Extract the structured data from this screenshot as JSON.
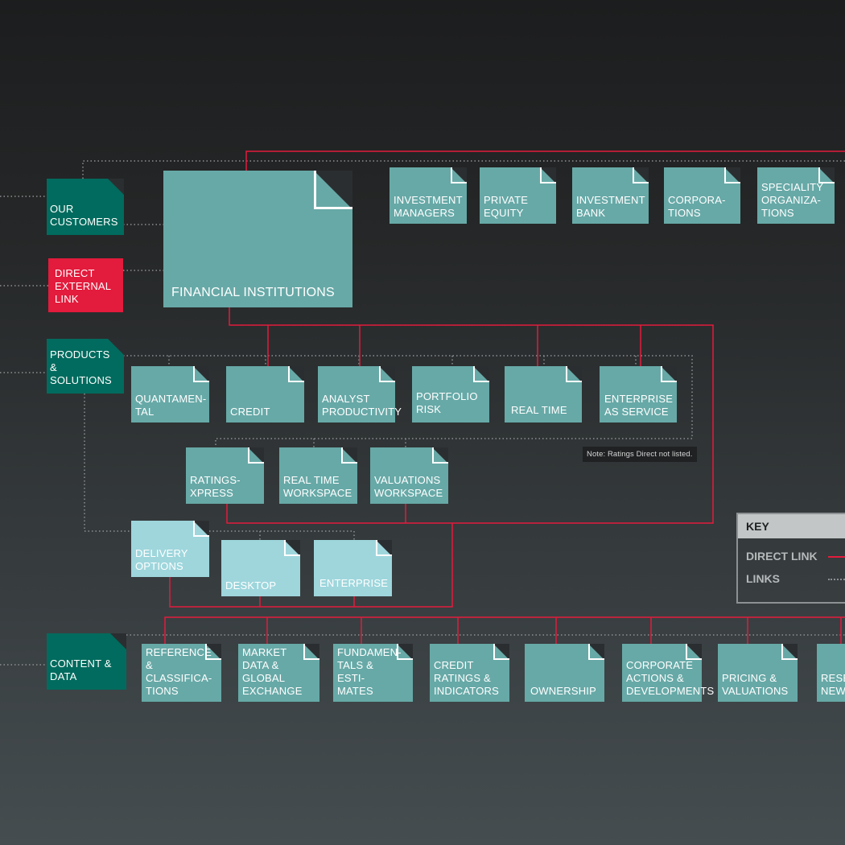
{
  "colors": {
    "teal": "#67a9a7",
    "dark_teal": "#006b5e",
    "red": "#e31b3c",
    "light_teal": "#9ed6dc",
    "direct_link": "#e31b3c",
    "link": "#8c9092"
  },
  "sidebar": {
    "our_customers": "OUR CUSTOMERS",
    "direct_external_link": "DIRECT EXTERNAL LINK",
    "products_solutions": "PRODUCTS & SOLUTIONS",
    "content_data": "CONTENT & DATA"
  },
  "financial_institutions": "FINANCIAL INSTITUTIONS",
  "customers": [
    "INVESTMENT MANAGERS",
    "PRIVATE EQUITY",
    "INVESTMENT BANK",
    "CORPORA- TIONS",
    "SPECIALITY ORGANIZA- TIONS"
  ],
  "products": [
    "QUANTAMEN- TAL",
    "CREDIT",
    "ANALYST PRODUCTIVITY",
    "PORTFOLIO RISK",
    "REAL TIME",
    "ENTERPRISE AS SERVICE"
  ],
  "sub_products": [
    "RATINGS- XPRESS",
    "REAL TIME WORKSPACE",
    "VALUATIONS WORKSPACE"
  ],
  "note": "Note: Ratings Direct not listed.",
  "delivery": {
    "options": "DELIVERY OPTIONS",
    "desktop": "DESKTOP",
    "enterprise": "ENTERPRISE"
  },
  "content": [
    "REFERENCE & CLASSIFICA- TIONS",
    "MARKET DATA & GLOBAL EXCHANGE",
    "FUNDAMEN- TALS & ESTI- MATES",
    "CREDIT RATINGS & INDICATORS",
    "OWNERSHIP",
    "CORPORATE ACTIONS & DEVELOPMENTS",
    "PRICING & VALUATIONS",
    "RESE NEWS"
  ],
  "key": {
    "title": "KEY",
    "direct_link": "DIRECT LINK",
    "links": "LINKS"
  }
}
